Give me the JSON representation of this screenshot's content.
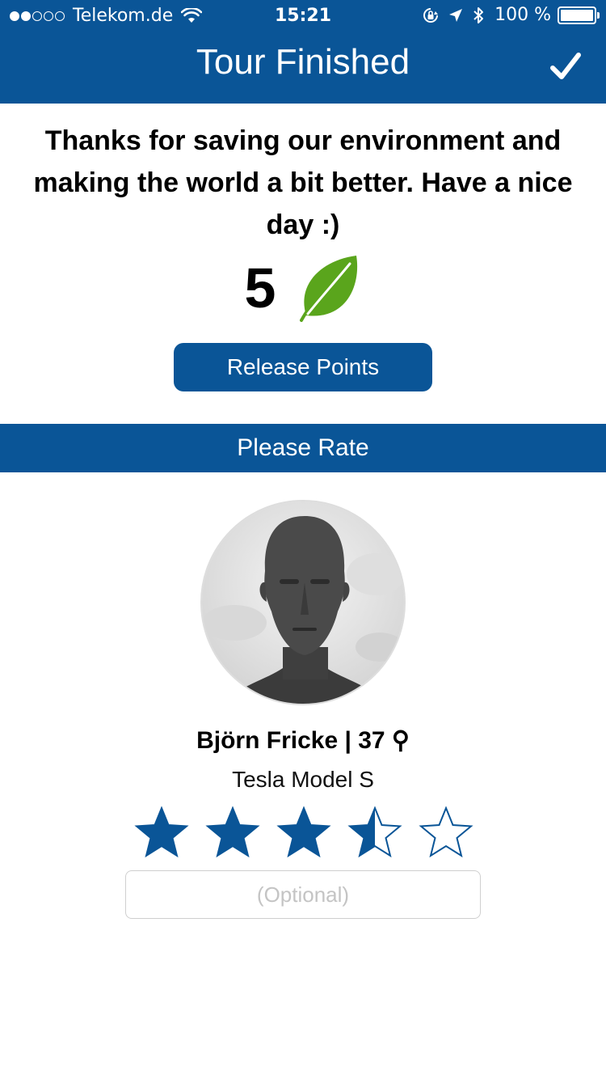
{
  "status_bar": {
    "signal_filled": 2,
    "signal_total": 5,
    "carrier": "Telekom.de",
    "time": "15:21",
    "battery": "100 %"
  },
  "nav": {
    "title": "Tour Finished",
    "done_icon": "checkmark-icon"
  },
  "message": "Thanks for saving our environment and making the world a bit better. Have a nice day :)",
  "points": {
    "value": "5",
    "icon": "leaf-icon"
  },
  "release_button": "Release Points",
  "rate_header": "Please Rate",
  "driver": {
    "name_line": "Björn Fricke | 37 ⚲",
    "car": "Tesla Model S",
    "rating": 3.5,
    "rating_max": 5
  },
  "comment": {
    "placeholder": "(Optional)",
    "value": ""
  },
  "colors": {
    "brand_blue": "#0a5597",
    "leaf_green": "#5aa51c"
  }
}
